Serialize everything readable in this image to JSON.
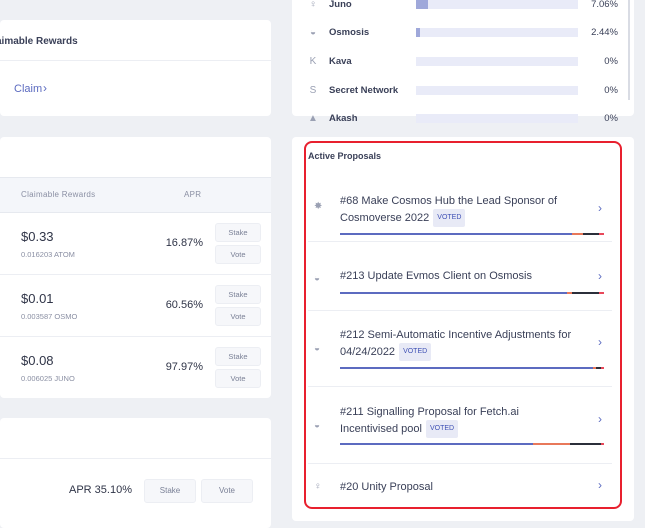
{
  "left": {
    "rewards_title": "Claimable Rewards",
    "claim_label": "Claim",
    "table_headers": {
      "rewards": "Claimable Rewards",
      "apr": "APR"
    },
    "rows": [
      {
        "amount": "$0.33",
        "sub": "0.016203 ATOM",
        "apr": "16.87%",
        "stake": "Stake",
        "vote": "Vote"
      },
      {
        "amount": "$0.01",
        "sub": "0.003587 OSMO",
        "apr": "60.56%",
        "stake": "Stake",
        "vote": "Vote"
      },
      {
        "amount": "$0.08",
        "sub": "0.006025 JUNO",
        "apr": "97.97%",
        "stake": "Stake",
        "vote": "Vote"
      }
    ],
    "validator": {
      "apr": "APR 35.10%",
      "stake": "Stake",
      "vote": "Vote"
    }
  },
  "chains": [
    {
      "icon": "juno-icon",
      "glyph": "♀",
      "name": "Juno",
      "percent": "7.06%",
      "fraction": 0.071
    },
    {
      "icon": "osmosis-icon",
      "glyph": "◒",
      "name": "Osmosis",
      "percent": "2.44%",
      "fraction": 0.024
    },
    {
      "icon": "kava-icon",
      "glyph": "K",
      "name": "Kava",
      "percent": "0%",
      "fraction": 0
    },
    {
      "icon": "secret-network-icon",
      "glyph": "S",
      "name": "Secret Network",
      "percent": "0%",
      "fraction": 0
    },
    {
      "icon": "akash-icon",
      "glyph": "▲",
      "name": "Akash",
      "percent": "0%",
      "fraction": 0
    }
  ],
  "proposals": {
    "title": "Active Proposals",
    "voted_label": "VOTED",
    "items": [
      {
        "icon": "cosmos-hub-icon",
        "glyph": "✸",
        "text": "#68 Make Cosmos Hub the Lead Sponsor of Cosmoverse 2022",
        "voted": true,
        "tally": {
          "yes": 0.88,
          "no": 0.04,
          "no_with_veto": 0.06,
          "abstain": 0.02
        }
      },
      {
        "icon": "osmosis-icon",
        "glyph": "◒",
        "text": "#213 Update Evmos Client on Osmosis",
        "voted": false,
        "tally": {
          "yes": 0.86,
          "no": 0.02,
          "no_with_veto": 0.1,
          "abstain": 0.02
        }
      },
      {
        "icon": "osmosis-icon",
        "glyph": "◒",
        "text": "#212 Semi-Automatic Incentive Adjustments for 04/24/2022",
        "voted": true,
        "tally": {
          "yes": 0.96,
          "no": 0.01,
          "no_with_veto": 0.02,
          "abstain": 0.01
        }
      },
      {
        "icon": "osmosis-icon",
        "glyph": "◒",
        "text": "#211 Signalling Proposal for Fetch.ai Incentivised pool",
        "voted": true,
        "tally": {
          "yes": 0.73,
          "no": 0.14,
          "no_with_veto": 0.12,
          "abstain": 0.01
        }
      },
      {
        "icon": "juno-icon",
        "glyph": "♀",
        "text": "#20 Unity Proposal",
        "voted": false,
        "tally": null
      }
    ]
  },
  "colors": {
    "yes": "#5c6bc0",
    "no": "#e8785a",
    "no_with_veto": "#2b2f3a",
    "abstain": "#e8485a",
    "highlight": "#e8202e",
    "accent": "#5c6bc0"
  }
}
